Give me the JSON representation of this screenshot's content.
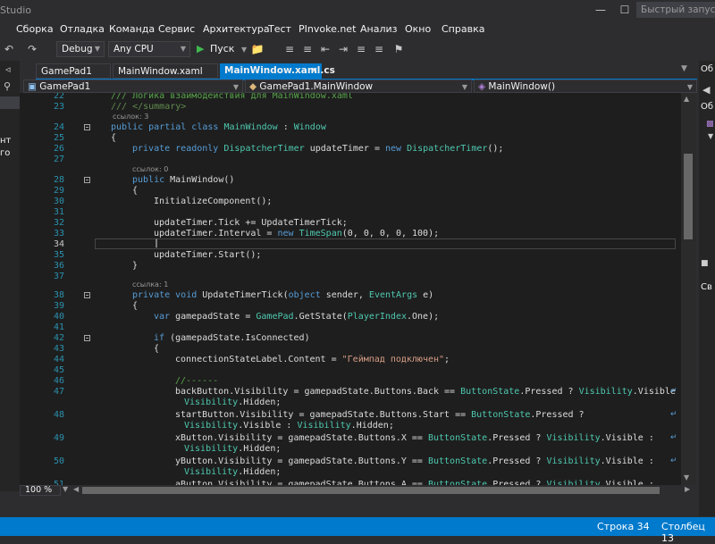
{
  "window": {
    "title": "Studio",
    "quick_launch_placeholder": "Быстрый запуск (Ctrl"
  },
  "menu": [
    "Сборка",
    "Отладка",
    "Команда",
    "Сервис",
    "Архитектура",
    "Тест",
    "PInvoke.net",
    "Анализ",
    "Окно",
    "Справка"
  ],
  "toolbar": {
    "config": "Debug",
    "platform": "Any CPU",
    "start_label": "Пуск"
  },
  "tabs": [
    {
      "label": "GamePad1",
      "active": false
    },
    {
      "label": "MainWindow.xaml",
      "active": false
    },
    {
      "label": "MainWindow.xaml.cs",
      "active": true
    }
  ],
  "nav": {
    "project": "GamePad1",
    "type": "GamePad1.MainWindow",
    "member": "MainWindow()"
  },
  "left_fragments": [
    "нт",
    "го"
  ],
  "editor": {
    "lines": [
      {
        "n": "22",
        "text": "/// Логика взаимодействия для MainWindow.xaml"
      },
      {
        "n": "23",
        "text": "/// </summary>"
      },
      {
        "n": "24",
        "text": "public partial class MainWindow : Window"
      },
      {
        "n": "25",
        "text": "{"
      },
      {
        "n": "26",
        "text": "private readonly DispatcherTimer updateTimer = new DispatcherTimer();"
      },
      {
        "n": "27",
        "text": ""
      },
      {
        "n": "28",
        "text": "public MainWindow()"
      },
      {
        "n": "29",
        "text": "{"
      },
      {
        "n": "30",
        "text": "InitializeComponent();"
      },
      {
        "n": "31",
        "text": ""
      },
      {
        "n": "32",
        "text": "updateTimer.Tick += UpdateTimerTick;"
      },
      {
        "n": "33",
        "text": "updateTimer.Interval = new TimeSpan(0, 0, 0, 0, 100);"
      },
      {
        "n": "34",
        "text": ""
      },
      {
        "n": "35",
        "text": "updateTimer.Start();"
      },
      {
        "n": "36",
        "text": "}"
      },
      {
        "n": "37",
        "text": ""
      },
      {
        "n": "38",
        "text": "private void UpdateTimerTick(object sender, EventArgs e)"
      },
      {
        "n": "39",
        "text": "{"
      },
      {
        "n": "40",
        "text": "var gamepadState = GamePad.GetState(PlayerIndex.One);"
      },
      {
        "n": "41",
        "text": ""
      },
      {
        "n": "42",
        "text": "if (gamepadState.IsConnected)"
      },
      {
        "n": "43",
        "text": "{"
      },
      {
        "n": "44",
        "text": "connectionStateLabel.Content = \"Геймпад подключен\";"
      },
      {
        "n": "45",
        "text": ""
      },
      {
        "n": "46",
        "text": "//------"
      },
      {
        "n": "47",
        "text": "backButton.Visibility = gamepadState.Buttons.Back == ButtonState.Pressed ? Visibility.Visible :"
      },
      {
        "n": "",
        "text": "Visibility.Hidden;"
      },
      {
        "n": "48",
        "text": "startButton.Visibility = gamepadState.Buttons.Start == ButtonState.Pressed ?"
      },
      {
        "n": "",
        "text": "Visibility.Visible : Visibility.Hidden;"
      },
      {
        "n": "49",
        "text": "xButton.Visibility = gamepadState.Buttons.X == ButtonState.Pressed ? Visibility.Visible :"
      },
      {
        "n": "",
        "text": "Visibility.Hidden;"
      },
      {
        "n": "50",
        "text": "yButton.Visibility = gamepadState.Buttons.Y == ButtonState.Pressed ? Visibility.Visible :"
      },
      {
        "n": "",
        "text": "Visibility.Hidden;"
      },
      {
        "n": "51",
        "text": "aButton.Visibility = gamepadState.Buttons.A == ButtonState.Pressed ? Visibility.Visible :"
      }
    ],
    "lens": [
      "ссылок: 3",
      "ссылок: 0",
      "ссылка: 1"
    ]
  },
  "zoom": "100 %",
  "status": {
    "line": "Строка 34",
    "column": "Столбец 13"
  },
  "right_fragments": [
    "Об",
    "Об",
    "Св"
  ],
  "colors": {
    "accent": "#007acc",
    "editor_bg": "#1e1e1e",
    "chrome_bg": "#2d2d30"
  }
}
